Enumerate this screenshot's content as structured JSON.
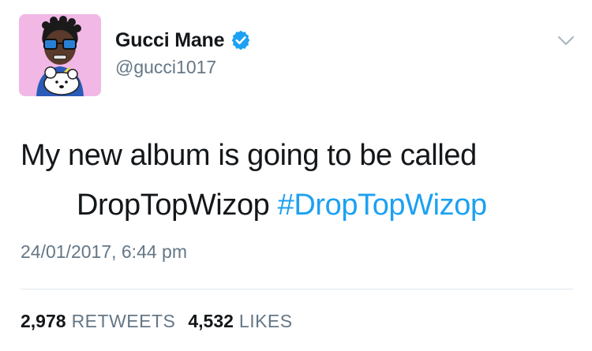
{
  "user": {
    "display_name": "Gucci Mane",
    "handle": "@gucci1017",
    "verified": true,
    "avatar_bg": "#f1b8e6"
  },
  "tweet": {
    "text_line1": "My new album is going to be called",
    "text_line2_plain": "DropTopWizop",
    "hashtag": "#DropTopWizop",
    "timestamp": "24/01/2017, 6:44 pm"
  },
  "stats": {
    "retweets_count": "2,978",
    "retweets_label": "RETWEETS",
    "likes_count": "4,532",
    "likes_label": "LIKES"
  },
  "icons": {
    "verified": "verified-badge-icon",
    "caret": "chevron-down-icon"
  },
  "colors": {
    "link": "#1da1f2",
    "secondary_text": "#657786",
    "primary_text": "#14171a",
    "divider": "#e1e8ed"
  }
}
